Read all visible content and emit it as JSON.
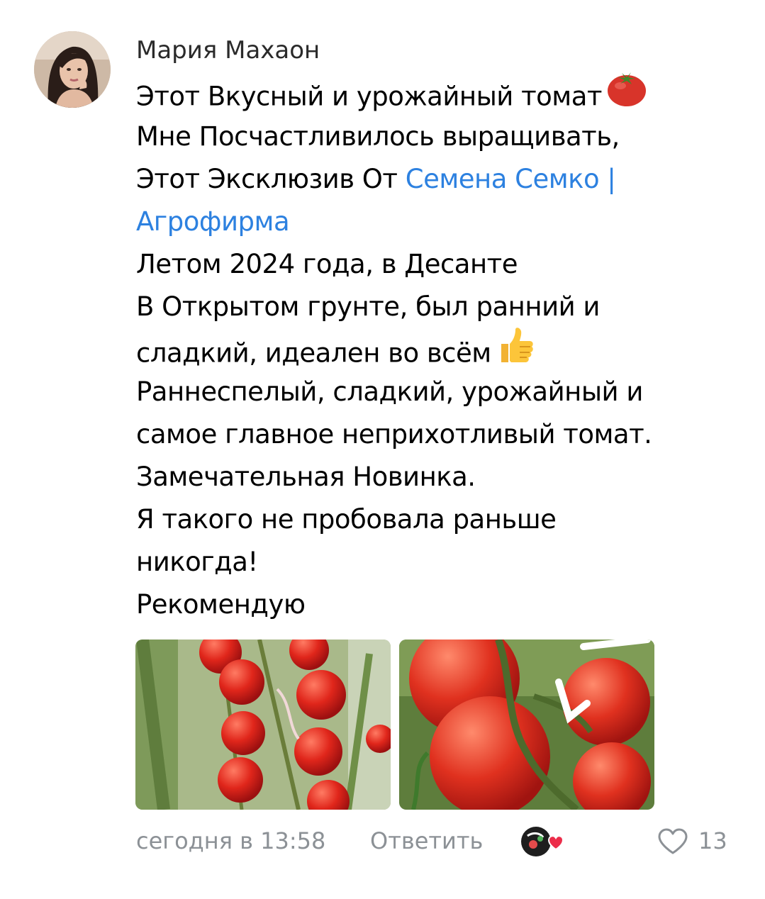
{
  "comment": {
    "author": "Мария Махаон",
    "lines": {
      "l1": "Этот Вкусный и урожайный томат",
      "l2": "Мне Посчастливилось выращивать,",
      "l3_prefix": "Этот Эксклюзив От ",
      "l3_link": "Семена Семко |",
      "l4_link": "Агрофирма",
      "l5": "Летом 2024 года, в Десанте",
      "l6": "В Открытом грунте, был ранний и",
      "l7": "сладкий, идеален во всём",
      "l8": "Раннеспелый, сладкий, урожайный и",
      "l9": "самое главное неприхотливый томат.",
      "l10": "Замечательная Новинка.",
      "l11": "Я такого не пробовала раньше",
      "l12": "никогда!",
      "l13": "Рекомендую"
    },
    "emojis": {
      "tomato": "tomato-icon",
      "thumbs_up": "thumbs-up-icon"
    },
    "photos": [
      "tomato-cluster-photo",
      "tomato-vine-photo"
    ],
    "footer": {
      "timestamp": "сегодня в 13:58",
      "reply_label": "Ответить",
      "like_count": "13"
    },
    "colors": {
      "text": "#000000",
      "link": "#2d81e0",
      "meta": "#8c9196",
      "author": "#2a2a2a"
    }
  }
}
